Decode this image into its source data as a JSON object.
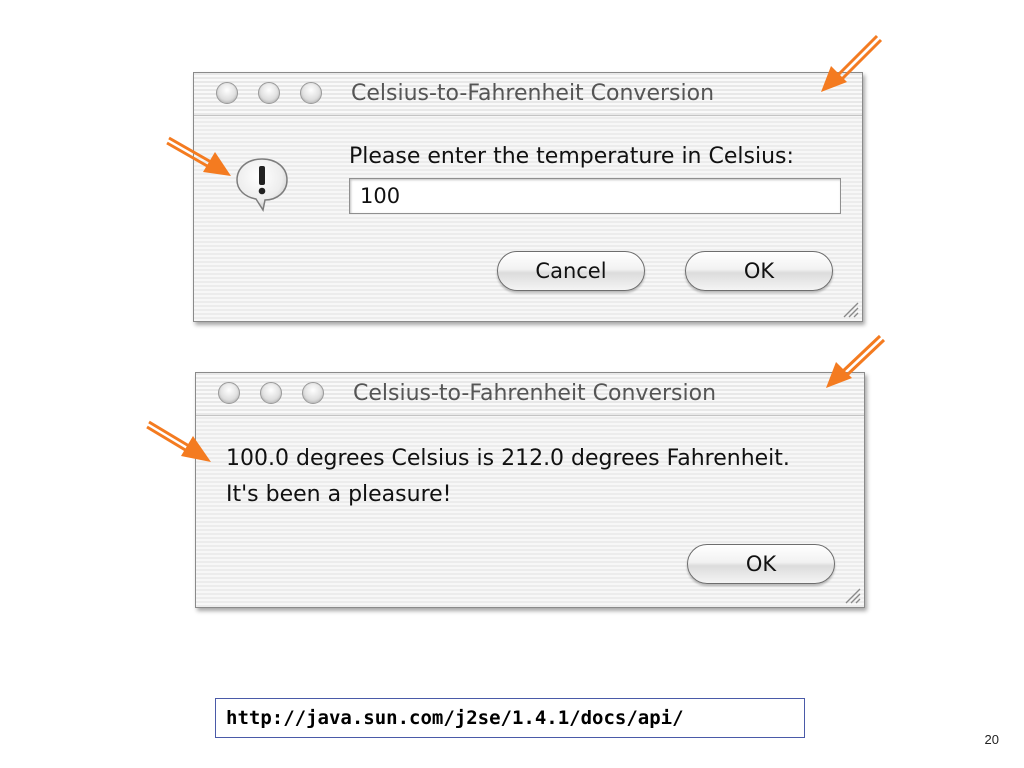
{
  "input_dialog": {
    "title": "Celsius-to-Fahrenheit Conversion",
    "icon": "alert-exclamation-icon",
    "prompt": "Please enter the temperature in Celsius:",
    "input_value": "100",
    "cancel_label": "Cancel",
    "ok_label": "OK"
  },
  "message_dialog": {
    "title": "Celsius-to-Fahrenheit Conversion",
    "message_line_1": "100.0 degrees Celsius is 212.0 degrees Fahrenheit.",
    "message_line_2": "It's been a pleasure!",
    "ok_label": "OK"
  },
  "footer": {
    "url": "http://java.sun.com/j2se/1.4.1/docs/api/",
    "page_number": "20"
  },
  "colors": {
    "arrow": "#f47b20",
    "url_border": "#4a5aa8"
  }
}
